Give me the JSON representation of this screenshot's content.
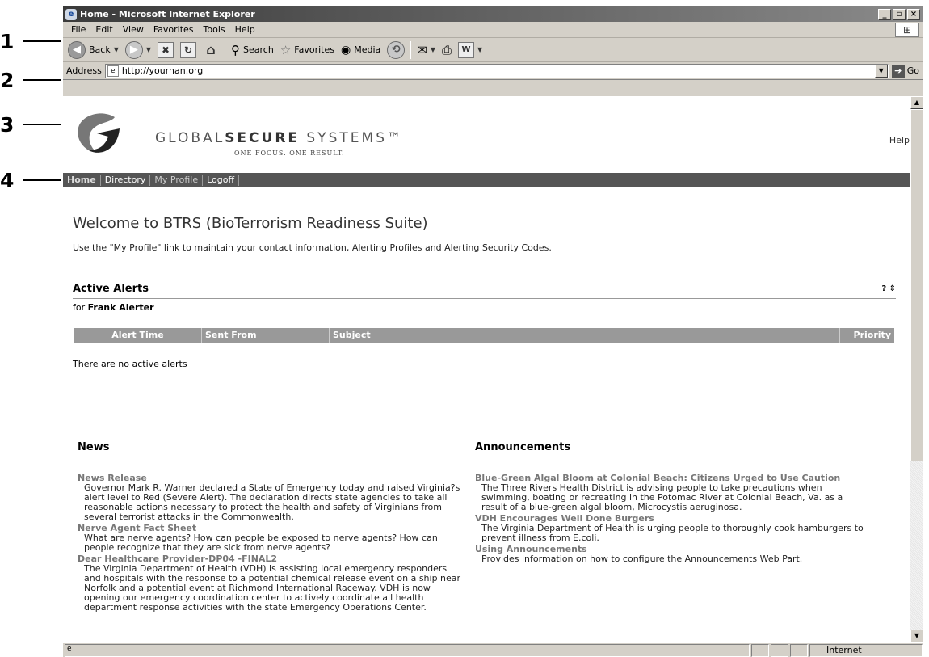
{
  "callouts": [
    "1",
    "2",
    "3",
    "4"
  ],
  "window": {
    "title": "Home - Microsoft Internet Explorer",
    "menu": [
      "File",
      "Edit",
      "View",
      "Favorites",
      "Tools",
      "Help"
    ],
    "toolbar": {
      "back": "Back",
      "search": "Search",
      "favorites": "Favorites",
      "media": "Media"
    },
    "address": {
      "label": "Address",
      "url": "http://yourhan.org",
      "go": "Go"
    },
    "status_zone": "Internet"
  },
  "header": {
    "brand_light": "GLOBAL",
    "brand_bold": "SECURE",
    "brand_rest": " SYSTEMS™",
    "tagline": "ONE FOCUS. ONE RESULT.",
    "help": "Help"
  },
  "nav": [
    "Home",
    "Directory",
    "My Profile",
    "Logoff"
  ],
  "main": {
    "welcome": "Welcome to BTRS (BioTerrorism Readiness Suite)",
    "intro": "Use the \"My Profile\" link to maintain your contact information, Alerting Profiles and Alerting Security Codes."
  },
  "alerts": {
    "title": "Active Alerts",
    "tools": "? ⇕",
    "for_label": "for ",
    "user": "Frank Alerter",
    "columns": [
      "Alert Time",
      "Sent From",
      "Subject",
      "Priority"
    ],
    "empty": "There are no active alerts"
  },
  "news": {
    "title": "News",
    "items": [
      {
        "title": "News Release",
        "desc": "Governor Mark R. Warner declared a State of Emergency today and raised Virginia?s alert level to Red (Severe Alert). The declaration directs state agencies to take all reasonable actions necessary to protect the health and safety of Virginians from several terrorist attacks in the Commonwealth."
      },
      {
        "title": "Nerve Agent Fact Sheet",
        "desc": "What are nerve agents? How can people be exposed to nerve agents? How can people recognize that they are sick from nerve agents?"
      },
      {
        "title": "Dear Healthcare Provider-DP04 -FINAL2",
        "desc": "The Virginia Department of Health (VDH) is assisting local emergency responders and hospitals with the response to a potential chemical release event on a ship near Norfolk and a potential event at Richmond International Raceway. VDH is now opening our emergency coordination center to actively coordinate all health department response activities with the state Emergency Operations Center."
      }
    ]
  },
  "announcements": {
    "title": "Announcements",
    "items": [
      {
        "title": "Blue-Green Algal Bloom at Colonial Beach: Citizens Urged to Use Caution",
        "desc": "The Three Rivers Health District is advising people to take precautions when swimming, boating or recreating in the Potomac River at Colonial Beach, Va. as a result of a blue-green algal bloom, Microcystis aeruginosa."
      },
      {
        "title": "VDH Encourages Well Done Burgers",
        "desc": "The Virginia Department of Health is urging people to thoroughly cook hamburgers to prevent illness from E.coli."
      },
      {
        "title": "Using Announcements",
        "desc": "Provides information on how to configure the Announcements Web Part."
      }
    ]
  }
}
